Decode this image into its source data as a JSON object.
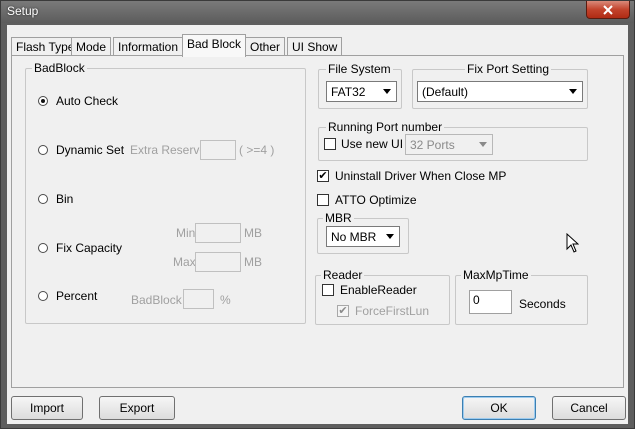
{
  "window": {
    "title": "Setup"
  },
  "tabs": [
    {
      "label": "Flash Type"
    },
    {
      "label": "Mode"
    },
    {
      "label": "Information"
    },
    {
      "label": "Bad Block",
      "active": true
    },
    {
      "label": "Other"
    },
    {
      "label": "UI Show"
    }
  ],
  "badblock": {
    "group_label": "BadBlock",
    "auto_check": "Auto Check",
    "dynamic_set": "Dynamic Set",
    "extra_reserve_label": "Extra Reserve",
    "extra_reserve_value": "",
    "extra_reserve_hint": "( >=4 )",
    "bin": "Bin",
    "fix_capacity": "Fix Capacity",
    "min_label": "Min",
    "min_value": "",
    "min_unit": "MB",
    "max_label": "Max",
    "max_value": "",
    "max_unit": "MB",
    "percent": "Percent",
    "badblock_label": "BadBlock",
    "badblock_value": "",
    "percent_unit": "%",
    "selected": "auto_check"
  },
  "file_system": {
    "label": "File System",
    "value": "FAT32"
  },
  "fix_port": {
    "label": "Fix Port Setting",
    "value": "(Default)"
  },
  "running_port": {
    "label": "Running Port number",
    "use_new_ui": "Use new UI",
    "use_new_ui_checked": false,
    "ports_value": "32 Ports"
  },
  "uninstall_driver": {
    "label": "Uninstall Driver When Close MP",
    "checked": true
  },
  "atto_optimize": {
    "label": "ATTO Optimize",
    "checked": false
  },
  "mbr": {
    "label": "MBR",
    "value": "No MBR"
  },
  "reader": {
    "label": "Reader",
    "enable_reader": "EnableReader",
    "enable_reader_checked": false,
    "force_first_lun": "ForceFirstLun",
    "force_first_lun_checked": true
  },
  "max_mp_time": {
    "label": "MaxMpTime",
    "value": "0",
    "unit": "Seconds"
  },
  "buttons": {
    "import": "Import",
    "export": "Export",
    "ok": "OK",
    "cancel": "Cancel"
  },
  "check_mark": "✔"
}
